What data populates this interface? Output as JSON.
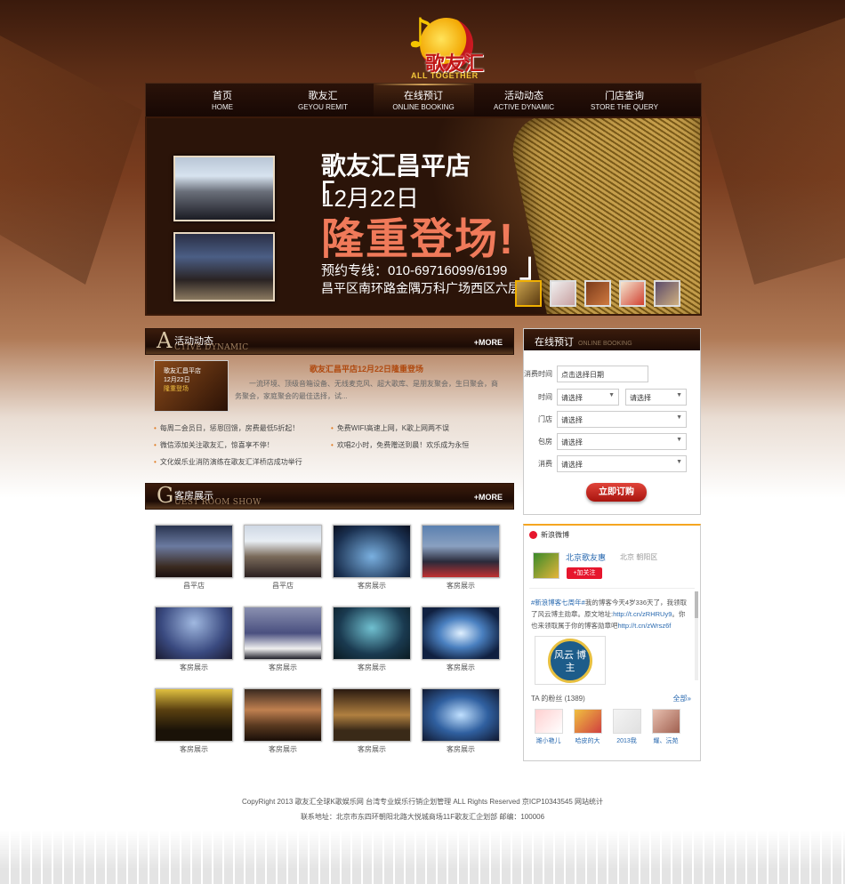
{
  "logo": {
    "cn": "歌友汇",
    "en": "ALL TOGETHER"
  },
  "nav": [
    {
      "cn": "首页",
      "en": "HOME"
    },
    {
      "cn": "歌友汇",
      "en": "GEYOU REMIT"
    },
    {
      "cn": "在线预订",
      "en": "ONLINE BOOKING"
    },
    {
      "cn": "活动动态",
      "en": "ACTIVE DYNAMIC"
    },
    {
      "cn": "门店查询",
      "en": "STORE THE QUERY"
    }
  ],
  "banner": {
    "title": "歌友汇昌平店",
    "date": "12月22日",
    "slogan": "隆重登场!",
    "phone": "预约专线：010-69716099/6199",
    "address": "昌平区南环路金隅万科广场西区六层"
  },
  "activity": {
    "cn": "活动动态",
    "en": "CTIVE DYNAMIC",
    "letter": "A",
    "more": "+MORE",
    "img_text": [
      "歌友汇昌平店",
      "12月22日",
      "隆重登场"
    ],
    "title": "歌友汇昌平店12月22日隆重登场",
    "desc": "一流环境、顶级音箱设备、无线麦克风、超大歌库、是朋友聚会，生日聚会，商务聚会，家庭聚会的最佳选择，试...",
    "news": [
      "每周二会员日，惩恩回馈，房费最低5折起！",
      "免费WIFI高速上网，K歌上网两不误",
      "微信添加关注歌友汇，惊喜享不停！",
      "欢唱2小时，免费赠送到晨！欢乐成为永恒",
      "文化娱乐业消防演练在歌友汇洋桥店成功举行"
    ]
  },
  "rooms": {
    "cn": "客房展示",
    "en": "UEST ROOM SHOW",
    "letter": "G",
    "more": "+MORE",
    "items": [
      "昌平店",
      "昌平店",
      "客房展示",
      "客房展示",
      "客房展示",
      "客房展示",
      "客房展示",
      "客房展示",
      "客房展示",
      "客房展示",
      "客房展示",
      "客房展示"
    ]
  },
  "booking": {
    "title": "在线预订",
    "en": "ONLINE BOOKING",
    "labels": {
      "date": "消费时间",
      "time": "时间",
      "store": "门店",
      "room": "包房",
      "type": "消费"
    },
    "date_value": "点击选择日期",
    "select": "请选择",
    "button": "立即订购"
  },
  "weibo": {
    "brand": "新浪微博",
    "name": "北京歌友惠",
    "location": "北京 朝阳区",
    "follow": "+加关注",
    "post_link1": "#新浪博客七周年#",
    "post_text": "我的博客今天4岁336天了，我领取了风云博主勋章。原文地址:",
    "post_link2": "http://t.cn/zRHRUy9",
    "post_text2": "。你也来领取属于你的博客勋章吧",
    "post_link3": "http://t.cn/zWrsz6f",
    "badge": "风云 博主",
    "fans_label": "TA 的粉丝 (1389)",
    "all": "全部»",
    "fans": [
      "潍小艳儿",
      "哈皮的大",
      "2013我",
      "耀、沅苑"
    ]
  },
  "footer": {
    "line1": "CopyRight 2013 歌友汇全球K歌娱乐网 台湾专业娱乐行销企划管理 ALL Rights Reserved 京ICP10343545 网站统计",
    "line2": "联系地址：北京市东四环朝阳北路大悦城商场11F歌友汇企划部 邮编：100006"
  },
  "colors": {
    "accent": "#c01515",
    "dark_brown": "#1c0b05",
    "link": "#2a6ab0",
    "button": "#c4241c"
  }
}
